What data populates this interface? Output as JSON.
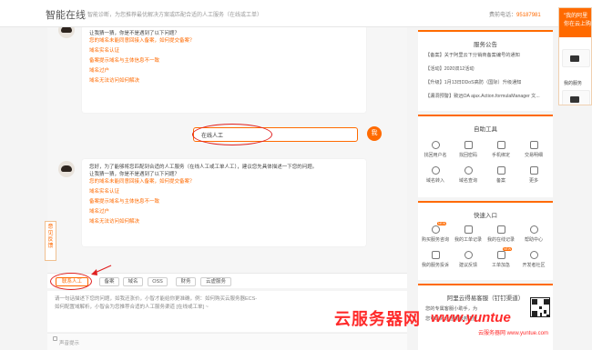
{
  "header": {
    "brand": "智能在线",
    "subtitle": "智能诊断，为您推荐最优解决方案或匹配合适的人工服务（在线或工单）",
    "hotline_label": "费前电话：",
    "hotline_number": "95187981"
  },
  "chat": {
    "first_bubble": {
      "lines": [
        "让我猜一猜，你是不是遇到了以下问题？"
      ],
      "links": [
        "您的域名未能同意回接入备案，如何提交备案？",
        "域名实名认证",
        "备案提示域名与主体信息不一致",
        "域名过户",
        "域名无法访问如何解决"
      ]
    },
    "user_message": "在线人工",
    "user_avatar": "我",
    "second_bubble": {
      "lines": [
        "您好，为了能够将您匹配到合适的人工服务（在线人工或工单人工），建议您先具体描述一下您的问题。",
        "让我猜一猜，你是不是遇到了以下问题？"
      ],
      "links": [
        "您的域名未能同意回接入备案，如何提交备案？",
        "域名实名认证",
        "备案提示域名与主体信息不一致",
        "域名过户",
        "域名无法访问如何解决"
      ]
    },
    "float_tab": [
      "意",
      "见",
      "反",
      "馈"
    ]
  },
  "quick_tags": [
    "联系人工",
    "备案",
    "域名",
    "OSS",
    "财务",
    "云虚服务"
  ],
  "input": {
    "placeholder_lines": [
      "请一句话描述下您的问题，如我还涨价，小智才能给你更准确，例：如何购买云服务器ECS-",
      "如何配置域解析，小智会为您推荐合适的人工服务渠道 [在线或工单] ~"
    ]
  },
  "footer": {
    "sound_label": "声音提示"
  },
  "sidebar": {
    "announcement": {
      "title": "服务公告",
      "items": [
        "【备案】关于阿里云下分销商备案编号的通知",
        "【活动】2020双12活动",
        "【升级】1月13日DDoS高防（国际）升级通知",
        "【漏洞预警】致远OA ajax.Action.formulaManager 文..."
      ]
    },
    "self_service": {
      "title": "自助工具",
      "tools": [
        "找回用户名",
        "找回密码",
        "手机绑定",
        "交易明细",
        "域名转入",
        "域名查询",
        "备案",
        "更多"
      ]
    },
    "quick_entry": {
      "title": "快速入口",
      "items": [
        "购买服务咨询",
        "我的工单记录",
        "我的在线记录",
        "帮助中心",
        "我的服务投诉",
        "建议反馈",
        "工单加急",
        "开发者社区"
      ],
      "badges": [
        "NEW",
        "NEW"
      ]
    },
    "dingtalk": {
      "title": "阿里云得易客服（钉钉渠道）",
      "lines": [
        "您的专属客服小助手，为",
        "您可以对话查询服务进度"
      ]
    }
  },
  "right_panel": {
    "title": "\"我的阿里",
    "subtitle": "你在云上购",
    "items": [
      "我的服务"
    ]
  },
  "watermark": {
    "cn": "云服务器网",
    "url": "www.yuntue",
    "small": "云服务器网 www.yuntue.com"
  }
}
